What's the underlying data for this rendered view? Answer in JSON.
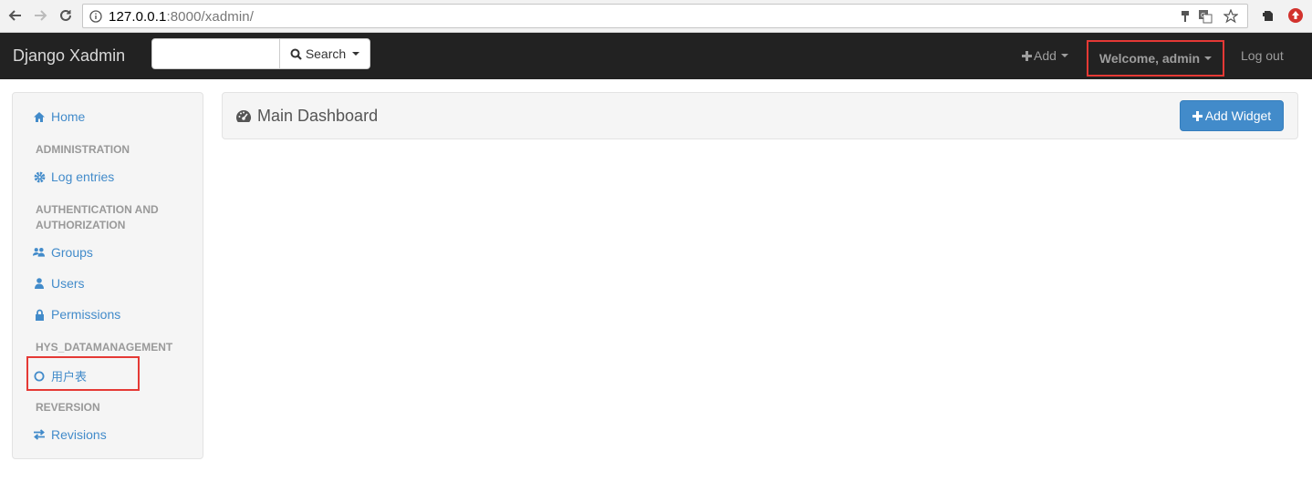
{
  "browser": {
    "url_host": "127.0.0.1",
    "url_path": ":8000/xadmin/"
  },
  "navbar": {
    "brand": "Django Xadmin",
    "search_value": "",
    "search_label": "Search",
    "add_label": "Add",
    "welcome_label": "Welcome, admin",
    "logout_label": "Log out"
  },
  "sidebar": {
    "items": [
      {
        "type": "link",
        "label": "Home",
        "icon": "home-icon"
      },
      {
        "type": "header",
        "label": "ADMINISTRATION"
      },
      {
        "type": "link",
        "label": "Log entries",
        "icon": "gear-icon"
      },
      {
        "type": "header",
        "label": "AUTHENTICATION AND AUTHORIZATION"
      },
      {
        "type": "link",
        "label": "Groups",
        "icon": "users-icon"
      },
      {
        "type": "link",
        "label": "Users",
        "icon": "user-icon"
      },
      {
        "type": "link",
        "label": "Permissions",
        "icon": "lock-icon"
      },
      {
        "type": "header",
        "label": "HYS_DATAMANAGEMENT"
      },
      {
        "type": "link",
        "label": "用户表",
        "icon": "circle-icon"
      },
      {
        "type": "header",
        "label": "REVERSION"
      },
      {
        "type": "link",
        "label": "Revisions",
        "icon": "exchange-icon"
      }
    ]
  },
  "main": {
    "title": "Main Dashboard",
    "add_widget_label": "Add Widget"
  },
  "colors": {
    "navbar_bg": "#222222",
    "link": "#428bca",
    "primary_button": "#428bca",
    "highlight": "#e53935"
  }
}
